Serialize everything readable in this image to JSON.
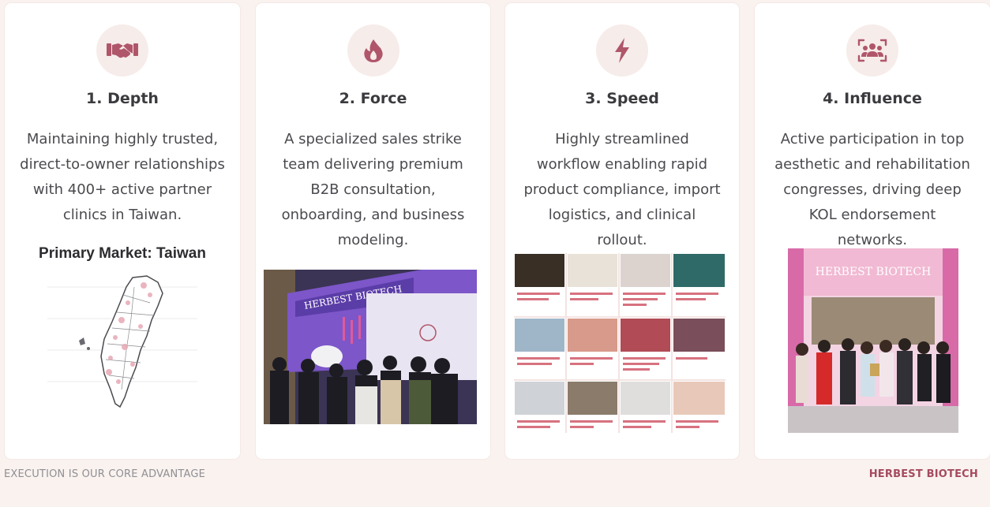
{
  "cards": [
    {
      "icon": "handshake-icon",
      "title": "1. Depth",
      "text": "Maintaining highly trusted, direct-to-owner relationships with 400+ active partner clinics in Taiwan.",
      "extra_title": "Primary Market: Taiwan"
    },
    {
      "icon": "fire-icon",
      "title": "2. Force",
      "text": "A specialized sales strike team delivering premium B2B consultation, onboarding, and business modeling.",
      "photo_sign": "HERBEST BIOTECH"
    },
    {
      "icon": "bolt-icon",
      "title": "3. Speed",
      "text": "Highly streamlined workflow enabling rapid product compliance, import logistics, and clinical rollout."
    },
    {
      "icon": "users-scan-icon",
      "title": "4. Influence",
      "text": "Active participation in top aesthetic and rehabilitation congresses, driving deep KOL endorsement networks.",
      "photo_sign": "HERBEST BIOTECH"
    }
  ],
  "footer": {
    "left": "EXECUTION IS OUR CORE ADVANTAGE",
    "right": "HERBEST BIOTECH"
  },
  "colors": {
    "accent": "#b0566a",
    "icon_bg": "#f6ecea",
    "page_bg": "#f9f2ef",
    "card_bg": "#ffffff"
  }
}
